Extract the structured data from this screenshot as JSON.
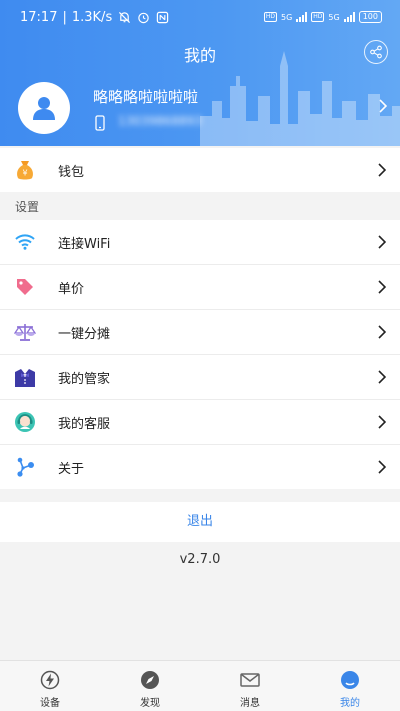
{
  "status_bar": {
    "time": "17:17",
    "network_speed": "1.3K/s",
    "signal_1": "5G",
    "signal_2": "5G",
    "hd_1": "HD",
    "hd_2": "HD",
    "battery": "100"
  },
  "header": {
    "title": "我的",
    "username": "略略略啦啦啦啦",
    "phone": "13039868893"
  },
  "menu": {
    "wallet": "钱包",
    "settings_section": "设置",
    "wifi": "连接WiFi",
    "unit_price": "单价",
    "split": "一键分摊",
    "butler": "我的管家",
    "service": "我的客服",
    "about": "关于"
  },
  "logout_label": "退出",
  "version": "v2.7.0",
  "tabs": {
    "device": "设备",
    "discover": "发现",
    "message": "消息",
    "mine": "我的"
  },
  "colors": {
    "accent": "#3a86e8",
    "header_start": "#3f8bf0",
    "header_end": "#63a8f4"
  }
}
